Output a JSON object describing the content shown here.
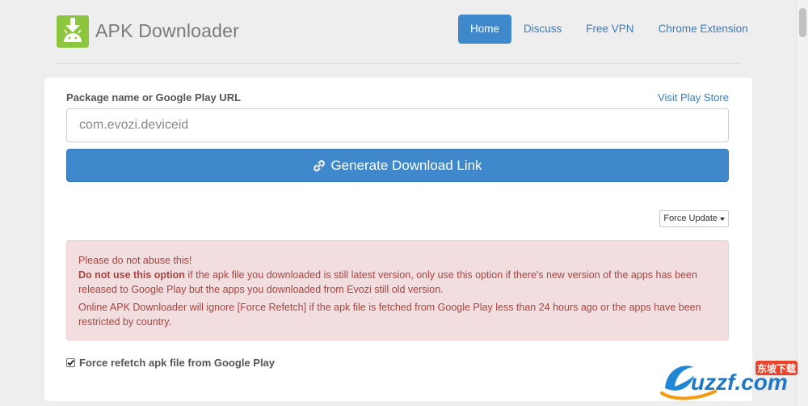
{
  "header": {
    "brand": "APK Downloader",
    "nav": [
      {
        "label": "Home",
        "active": true
      },
      {
        "label": "Discuss",
        "active": false
      },
      {
        "label": "Free VPN",
        "active": false
      },
      {
        "label": "Chrome Extension",
        "active": false
      }
    ]
  },
  "form": {
    "label": "Package name or Google Play URL",
    "play_store_link": "Visit Play Store",
    "input_placeholder": "com.evozi.deviceid",
    "input_value": "",
    "generate_label": "Generate Download Link",
    "dropdown_label": "Force Update"
  },
  "alert": {
    "line1": "Please do not abuse this!",
    "line2_bold": "Do not use this option",
    "line2_rest": " if the apk file you downloaded is still latest version, only use this option if there's new version of the apps has been released to Google Play but the apps you downloaded from Evozi still old version.",
    "line3": "Online APK Downloader will ignore [Force Refetch] if the apk file is fetched from Google Play less than 24 hours ago or the apps have been restricted by country."
  },
  "checkbox": {
    "label": "Force refetch apk file from Google Play",
    "checked": true
  },
  "watermark": {
    "text": "uzzf.com",
    "tag": "东坡下载"
  },
  "colors": {
    "accent": "#3f88cc",
    "link": "#3a7cc3",
    "alert_bg": "#f2dede",
    "alert_text": "#a94442",
    "android_green": "#8cc63f"
  }
}
